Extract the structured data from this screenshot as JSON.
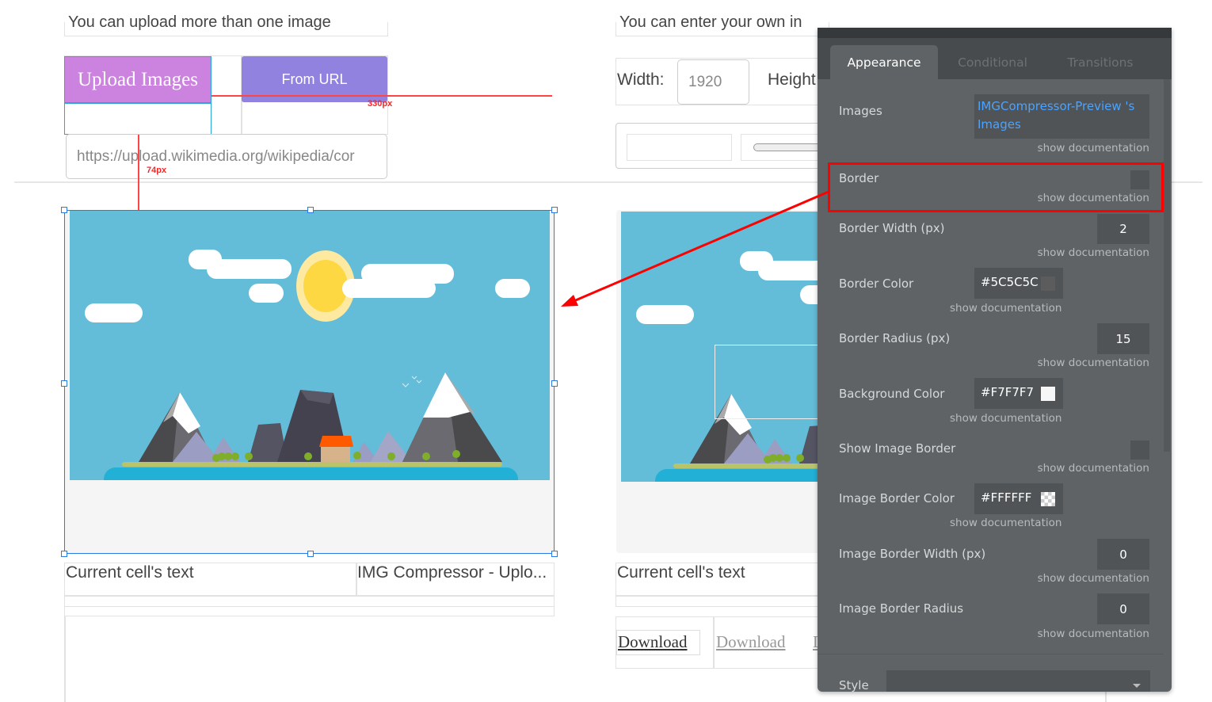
{
  "left_column": {
    "caption": "You can upload more than one image",
    "upload_button": "Upload Images",
    "url_button": "From URL",
    "url_input_value": "https://upload.wikimedia.org/wikipedia/cor",
    "measure_horizontal": "330px",
    "measure_vertical": "74px",
    "cell_text": "Current cell's text",
    "cell_title": "IMG Compressor - Uplo..."
  },
  "right_column": {
    "caption": "You can enter your own in",
    "width_label": "Width:",
    "width_value": "1920",
    "height_label": "Height",
    "cell_text": "Current cell's text",
    "download_primary": "Download",
    "download_secondary": "Download",
    "download_third": "D"
  },
  "panel": {
    "tabs": [
      "Appearance",
      "Conditional",
      "Transitions"
    ],
    "active_tab": "Appearance",
    "doc_link": "show documentation",
    "images_label": "Images",
    "images_value": "IMGCompressor-Preview 's Images",
    "border_label": "Border",
    "border_checked": false,
    "border_width_label": "Border Width (px)",
    "border_width": "2",
    "border_color_label": "Border Color",
    "border_color": "#5C5C5C",
    "border_radius_label": "Border Radius (px)",
    "border_radius": "15",
    "bg_color_label": "Background Color",
    "bg_color": "#F7F7F7",
    "show_image_border_label": "Show Image Border",
    "show_image_border_checked": false,
    "image_border_color_label": "Image Border Color",
    "image_border_color": "#FFFFFF",
    "image_border_width_label": "Image Border Width (px)",
    "image_border_width": "0",
    "image_border_radius_label": "Image Border Radius",
    "image_border_radius": "0",
    "style_label": "Style",
    "style_value": ""
  },
  "colors": {
    "highlight": "#ff0000",
    "selection": "#2a7be4",
    "upload_button": "#cc82df",
    "url_button": "#9182e0",
    "panel_bg": "#5f6366",
    "link": "#4aa3ff"
  }
}
